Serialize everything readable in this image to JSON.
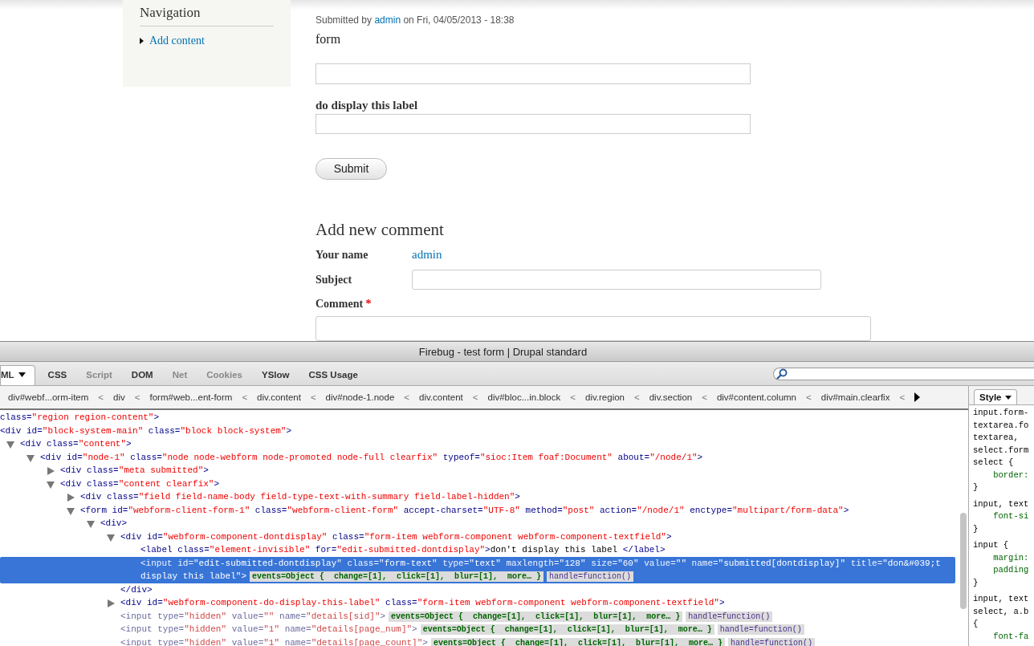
{
  "page": {
    "sidebar": {
      "title": "Navigation",
      "links": [
        "Add content"
      ]
    },
    "submitted": {
      "prefix": "Submitted by",
      "author": "admin",
      "suffix": "on Fri, 04/05/2013 - 18:38"
    },
    "form": {
      "title": "form",
      "fields": [
        {
          "kind": "text"
        },
        {
          "kind": "text",
          "label": "do display this label"
        }
      ],
      "button": "Submit"
    },
    "comment": {
      "heading": "Add new comment",
      "rows": [
        {
          "kind": "value",
          "label": "Your name",
          "value": "admin"
        },
        {
          "kind": "input",
          "label": "Subject"
        },
        {
          "kind": "textarea",
          "label": "Comment",
          "required_mark": "*"
        }
      ]
    }
  },
  "firebug": {
    "title": "Firebug - test form | Drupal standard",
    "tabs": [
      {
        "label": "ML",
        "selected": true,
        "disabled": false,
        "dropdown": true
      },
      {
        "label": "CSS",
        "selected": false,
        "disabled": false,
        "dropdown": false
      },
      {
        "label": "Script",
        "selected": false,
        "disabled": true,
        "dropdown": false
      },
      {
        "label": "DOM",
        "selected": false,
        "disabled": false,
        "dropdown": false
      },
      {
        "label": "Net",
        "selected": false,
        "disabled": true,
        "dropdown": false
      },
      {
        "label": "Cookies",
        "selected": false,
        "disabled": true,
        "dropdown": false
      },
      {
        "label": "YSlow",
        "selected": false,
        "disabled": false,
        "dropdown": false
      },
      {
        "label": "CSS Usage",
        "selected": false,
        "disabled": false,
        "dropdown": false
      }
    ],
    "breadcrumbs": [
      {
        "label": "div#webf...orm-item",
        "separator": "<"
      },
      {
        "label": "div",
        "separator": "<"
      },
      {
        "label": "form#web...ent-form",
        "separator": "<"
      },
      {
        "label": "div.content",
        "separator": "<"
      },
      {
        "label": "div#node-1.node",
        "separator": "<"
      },
      {
        "label": "div.content",
        "separator": "<"
      },
      {
        "label": "div#bloc...in.block",
        "separator": "<"
      },
      {
        "label": "div.region",
        "separator": "<"
      },
      {
        "label": "div.section",
        "separator": "<"
      },
      {
        "label": "div#content.column",
        "separator": "<"
      },
      {
        "label": "div#main.clearfix",
        "separator": "<"
      }
    ],
    "tree": [
      {
        "selected": false,
        "tokens": [
          {
            "kind": "attr",
            "t": "class="
          },
          {
            "kind": "val",
            "t": "\"region region-content\""
          },
          {
            "kind": "tag",
            "t": ">"
          }
        ]
      },
      {
        "selected": false,
        "tokens": [
          {
            "kind": "tag",
            "t": "<div"
          },
          {
            "kind": "attr",
            "t": " id="
          },
          {
            "kind": "val",
            "t": "\"block-system-main\""
          },
          {
            "kind": "attr",
            "t": " class="
          },
          {
            "kind": "val",
            "t": "\"block block-system\""
          },
          {
            "kind": "tag",
            "t": ">"
          }
        ],
        "children": [
          {
            "selected": false,
            "expanded": true,
            "tokens": [
              {
                "kind": "tag",
                "t": "<div"
              },
              {
                "kind": "attr",
                "t": " class="
              },
              {
                "kind": "val",
                "t": "\"content\""
              },
              {
                "kind": "tag",
                "t": ">"
              }
            ],
            "children": [
              {
                "selected": false,
                "expanded": true,
                "tokens": [
                  {
                    "kind": "tag",
                    "t": "<div"
                  },
                  {
                    "kind": "attr",
                    "t": " id="
                  },
                  {
                    "kind": "val",
                    "t": "\"node-1\""
                  },
                  {
                    "kind": "attr",
                    "t": " class="
                  },
                  {
                    "kind": "val",
                    "t": "\"node node-webform node-promoted node-full clearfix\""
                  },
                  {
                    "kind": "attr",
                    "t": " typeof="
                  },
                  {
                    "kind": "val",
                    "t": "\"sioc:Item foaf:Document\""
                  },
                  {
                    "kind": "attr",
                    "t": " about="
                  },
                  {
                    "kind": "val",
                    "t": "\"/node/1\""
                  },
                  {
                    "kind": "tag",
                    "t": ">"
                  }
                ],
                "children": [
                  {
                    "selected": false,
                    "expanded": false,
                    "tokens": [
                      {
                        "kind": "tag",
                        "t": "<div"
                      },
                      {
                        "kind": "attr",
                        "t": " class="
                      },
                      {
                        "kind": "val",
                        "t": "\"meta submitted\""
                      },
                      {
                        "kind": "tag",
                        "t": ">"
                      }
                    ]
                  },
                  {
                    "selected": false,
                    "expanded": true,
                    "tokens": [
                      {
                        "kind": "tag",
                        "t": "<div"
                      },
                      {
                        "kind": "attr",
                        "t": " class="
                      },
                      {
                        "kind": "val",
                        "t": "\"content clearfix\""
                      },
                      {
                        "kind": "tag",
                        "t": ">"
                      }
                    ],
                    "children": [
                      {
                        "selected": false,
                        "expanded": false,
                        "tokens": [
                          {
                            "kind": "tag",
                            "t": "<div"
                          },
                          {
                            "kind": "attr",
                            "t": " class="
                          },
                          {
                            "kind": "val",
                            "t": "\"field field-name-body field-type-text-with-summary field-label-hidden\""
                          },
                          {
                            "kind": "tag",
                            "t": ">"
                          }
                        ]
                      },
                      {
                        "selected": false,
                        "expanded": true,
                        "tokens": [
                          {
                            "kind": "tag",
                            "t": "<form"
                          },
                          {
                            "kind": "attr",
                            "t": " id="
                          },
                          {
                            "kind": "val",
                            "t": "\"webform-client-form-1\""
                          },
                          {
                            "kind": "attr",
                            "t": " class="
                          },
                          {
                            "kind": "val",
                            "t": "\"webform-client-form\""
                          },
                          {
                            "kind": "attr",
                            "t": " accept-charset="
                          },
                          {
                            "kind": "val",
                            "t": "\"UTF-8\""
                          },
                          {
                            "kind": "attr",
                            "t": " method="
                          },
                          {
                            "kind": "val",
                            "t": "\"post\""
                          },
                          {
                            "kind": "attr",
                            "t": " action="
                          },
                          {
                            "kind": "val",
                            "t": "\"/node/1\""
                          },
                          {
                            "kind": "attr",
                            "t": " enctype="
                          },
                          {
                            "kind": "val",
                            "t": "\"multipart/form-data\""
                          },
                          {
                            "kind": "tag",
                            "t": ">"
                          }
                        ],
                        "children": [
                          {
                            "selected": false,
                            "expanded": true,
                            "tokens": [
                              {
                                "kind": "tag",
                                "t": "<div>"
                              }
                            ],
                            "children": [
                              {
                                "selected": false,
                                "expanded": true,
                                "tokens": [
                                  {
                                    "kind": "tag",
                                    "t": "<div"
                                  },
                                  {
                                    "kind": "attr",
                                    "t": " id="
                                  },
                                  {
                                    "kind": "val",
                                    "t": "\"webform-component-dontdisplay\""
                                  },
                                  {
                                    "kind": "attr",
                                    "t": " class="
                                  },
                                  {
                                    "kind": "val",
                                    "t": "\"form-item webform-component webform-component-textfield\""
                                  },
                                  {
                                    "kind": "tag",
                                    "t": ">"
                                  }
                                ],
                                "children": [
                                  {
                                    "selected": false,
                                    "tokens": [
                                      {
                                        "kind": "tag",
                                        "t": "<label"
                                      },
                                      {
                                        "kind": "attr",
                                        "t": " class="
                                      },
                                      {
                                        "kind": "val",
                                        "t": "\"element-invisible\""
                                      },
                                      {
                                        "kind": "attr",
                                        "t": " for="
                                      },
                                      {
                                        "kind": "val",
                                        "t": "\"edit-submitted-dontdisplay\""
                                      },
                                      {
                                        "kind": "tag",
                                        "t": ">"
                                      },
                                      {
                                        "kind": "text",
                                        "t": "don't display this label "
                                      },
                                      {
                                        "kind": "tag",
                                        "t": "</label>"
                                      }
                                    ]
                                  },
                                  {
                                    "selected": true,
                                    "tokens": [
                                      {
                                        "kind": "tag",
                                        "t": "<input"
                                      },
                                      {
                                        "kind": "attr",
                                        "t": " id="
                                      },
                                      {
                                        "kind": "val",
                                        "t": "\"edit-submitted-dontdisplay\""
                                      },
                                      {
                                        "kind": "attr",
                                        "t": " class="
                                      },
                                      {
                                        "kind": "val",
                                        "t": "\"form-text\""
                                      },
                                      {
                                        "kind": "attr",
                                        "t": " type="
                                      },
                                      {
                                        "kind": "val",
                                        "t": "\"text\""
                                      },
                                      {
                                        "kind": "attr",
                                        "t": " maxlength="
                                      },
                                      {
                                        "kind": "val",
                                        "t": "\"128\""
                                      },
                                      {
                                        "kind": "attr",
                                        "t": " size="
                                      },
                                      {
                                        "kind": "val",
                                        "t": "\"60\""
                                      },
                                      {
                                        "kind": "attr",
                                        "t": " value="
                                      },
                                      {
                                        "kind": "val",
                                        "t": "\"\""
                                      },
                                      {
                                        "kind": "attr",
                                        "t": " name="
                                      },
                                      {
                                        "kind": "val",
                                        "t": "\"submitted[dontdisplay]\""
                                      },
                                      {
                                        "kind": "attr",
                                        "t": " title="
                                      },
                                      {
                                        "kind": "val",
                                        "t": "\"don&#039;t"
                                      }
                                    ],
                                    "continued": "display this label\">",
                                    "badges": [
                                      {
                                        "kind": "events",
                                        "text": "events=Object {  change=[1],  click=[1],  blur=[1],  more… }"
                                      },
                                      {
                                        "kind": "handle",
                                        "text": "handle=function()"
                                      }
                                    ]
                                  }
                                ]
                              },
                              {
                                "selected": false,
                                "tokens": [
                                  {
                                    "kind": "tag",
                                    "t": "</div>"
                                  }
                                ]
                              },
                              {
                                "selected": false,
                                "expanded": false,
                                "tokens": [
                                  {
                                    "kind": "tag",
                                    "t": "<div"
                                  },
                                  {
                                    "kind": "attr",
                                    "t": " id="
                                  },
                                  {
                                    "kind": "val",
                                    "t": "\"webform-component-do-display-this-label\""
                                  },
                                  {
                                    "kind": "attr",
                                    "t": " class="
                                  },
                                  {
                                    "kind": "val",
                                    "t": "\"form-item webform-component webform-component-textfield\""
                                  },
                                  {
                                    "kind": "tag",
                                    "t": ">"
                                  }
                                ]
                              },
                              {
                                "selected": false,
                                "tokens": [
                                  {
                                    "kind": "dtag",
                                    "t": "<input"
                                  },
                                  {
                                    "kind": "dattr",
                                    "t": " type="
                                  },
                                  {
                                    "kind": "dval",
                                    "t": "\"hidden\""
                                  },
                                  {
                                    "kind": "dattr",
                                    "t": " value="
                                  },
                                  {
                                    "kind": "dval",
                                    "t": "\"\""
                                  },
                                  {
                                    "kind": "dattr",
                                    "t": " name="
                                  },
                                  {
                                    "kind": "dval",
                                    "t": "\"details[sid]\""
                                  },
                                  {
                                    "kind": "dtag",
                                    "t": ">"
                                  }
                                ],
                                "badges": [
                                  {
                                    "kind": "events",
                                    "text": "events=Object {  change=[1],  click=[1],  blur=[1],  more… }"
                                  },
                                  {
                                    "kind": "handle",
                                    "text": "handle=function()"
                                  }
                                ]
                              },
                              {
                                "selected": false,
                                "tokens": [
                                  {
                                    "kind": "dtag",
                                    "t": "<input"
                                  },
                                  {
                                    "kind": "dattr",
                                    "t": " type="
                                  },
                                  {
                                    "kind": "dval",
                                    "t": "\"hidden\""
                                  },
                                  {
                                    "kind": "dattr",
                                    "t": " value="
                                  },
                                  {
                                    "kind": "dval",
                                    "t": "\"1\""
                                  },
                                  {
                                    "kind": "dattr",
                                    "t": " name="
                                  },
                                  {
                                    "kind": "dval",
                                    "t": "\"details[page_num]\""
                                  },
                                  {
                                    "kind": "dtag",
                                    "t": ">"
                                  }
                                ],
                                "badges": [
                                  {
                                    "kind": "events",
                                    "text": "events=Object {  change=[1],  click=[1],  blur=[1],  more… }"
                                  },
                                  {
                                    "kind": "handle",
                                    "text": "handle=function()"
                                  }
                                ]
                              },
                              {
                                "selected": false,
                                "tokens": [
                                  {
                                    "kind": "dtag",
                                    "t": "<input"
                                  },
                                  {
                                    "kind": "dattr",
                                    "t": " type="
                                  },
                                  {
                                    "kind": "dval",
                                    "t": "\"hidden\""
                                  },
                                  {
                                    "kind": "dattr",
                                    "t": " value="
                                  },
                                  {
                                    "kind": "dval",
                                    "t": "\"1\""
                                  },
                                  {
                                    "kind": "dattr",
                                    "t": " name="
                                  },
                                  {
                                    "kind": "dval",
                                    "t": "\"details[page_count]\""
                                  },
                                  {
                                    "kind": "dtag",
                                    "t": ">"
                                  }
                                ],
                                "badges": [
                                  {
                                    "kind": "events",
                                    "text": "events=Object {  change=[1],  click=[1],  blur=[1],  more… }"
                                  },
                                  {
                                    "kind": "handle",
                                    "text": "handle=function()"
                                  }
                                ]
                              }
                            ]
                          }
                        ]
                      }
                    ]
                  }
                ]
              }
            ]
          }
        ]
      }
    ],
    "side_tab": "Style",
    "css_rules": [
      [
        {
          "kind": "sel",
          "t": "input.form-"
        },
        {
          "kind": "sel",
          "t": "textarea.fo"
        },
        {
          "kind": "sel",
          "t": "textarea,"
        },
        {
          "kind": "sel",
          "t": "select.form"
        },
        {
          "kind": "sel",
          "t": "select {"
        },
        {
          "kind": "prop",
          "t": "    border:"
        },
        {
          "kind": "sel",
          "t": "}"
        }
      ],
      [
        {
          "kind": "sel",
          "t": "input, text"
        },
        {
          "kind": "prop",
          "t": "    font-si"
        },
        {
          "kind": "sel",
          "t": "}"
        }
      ],
      [
        {
          "kind": "sel",
          "t": "input {"
        },
        {
          "kind": "prop",
          "t": "    margin:"
        },
        {
          "kind": "prop",
          "t": "    padding"
        },
        {
          "kind": "sel",
          "t": "}"
        }
      ],
      [
        {
          "kind": "sel",
          "t": "input, text"
        },
        {
          "kind": "sel",
          "t": "select, a.b"
        },
        {
          "kind": "sel",
          "t": "{"
        },
        {
          "kind": "prop",
          "t": "    font-fa"
        }
      ]
    ]
  }
}
